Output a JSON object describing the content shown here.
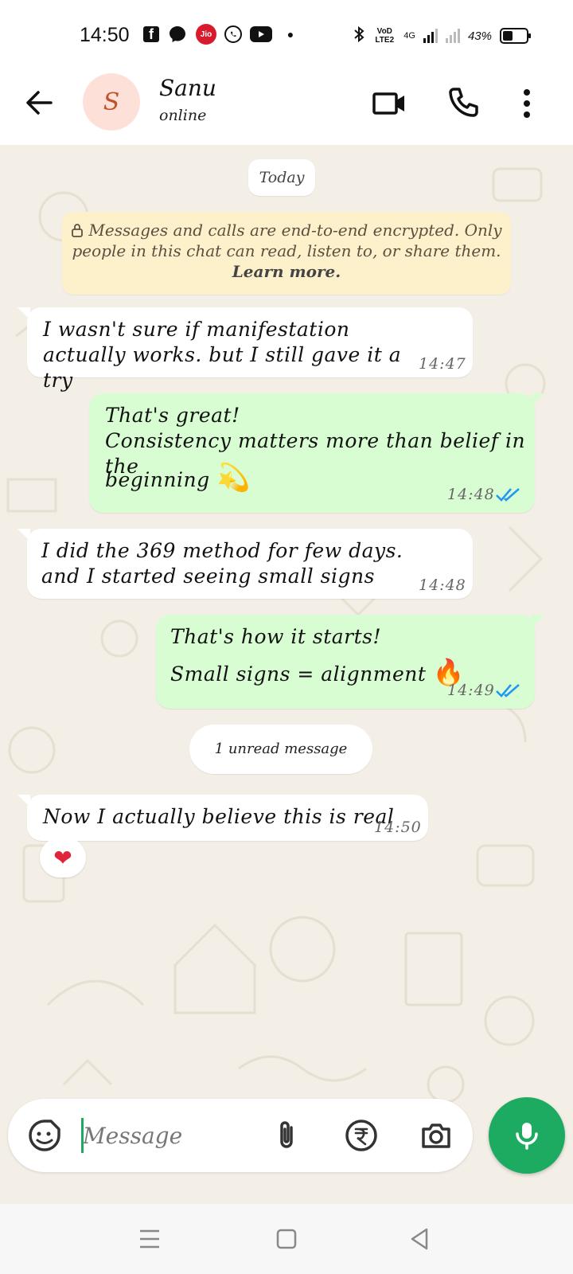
{
  "status_bar": {
    "time": "14:50",
    "network_label": "VoD LTE2",
    "network_type": "4G",
    "battery_percent": "43%",
    "battery_level": 0.43,
    "icons": [
      "facebook-icon",
      "messenger-icon",
      "jio-icon",
      "whatsapp-icon",
      "youtube-icon",
      "bluetooth-icon"
    ]
  },
  "header": {
    "avatar_initial": "S",
    "contact_name": "Sanu",
    "contact_status": "online"
  },
  "chat": {
    "date_label": "Today",
    "encryption_notice": "Messages and calls are end-to-end encrypted. Only people in this chat can read, listen to, or share them.",
    "encryption_link": "Learn more.",
    "unread_label": "1 unread message",
    "messages": [
      {
        "direction": "in",
        "text": "I wasn't sure if manifestation actually works.  but I still gave it a try",
        "time": "14:47"
      },
      {
        "direction": "out",
        "line1": "That's great!",
        "line2": "Consistency matters more than belief in the",
        "line3": "beginning",
        "emoji": "💫",
        "time": "14:48",
        "status": "read"
      },
      {
        "direction": "in",
        "text": "I did the 369 method for few days.  and I started seeing small  signs",
        "time": "14:48"
      },
      {
        "direction": "out",
        "line1": "That's how it starts!",
        "line2": "Small signs = alignment",
        "emoji": "🔥",
        "time": "14:49",
        "status": "read"
      },
      {
        "direction": "in",
        "text": "Now I actually believe this is real",
        "time": "14:50",
        "reaction": "❤"
      }
    ]
  },
  "input": {
    "placeholder": "Message",
    "value": ""
  },
  "colors": {
    "accent": "#1daa61",
    "outgoing_bubble": "#d9fdd3",
    "incoming_bubble": "#ffffff",
    "read_ticks": "#2196f3",
    "chat_background": "#f3efe7"
  }
}
